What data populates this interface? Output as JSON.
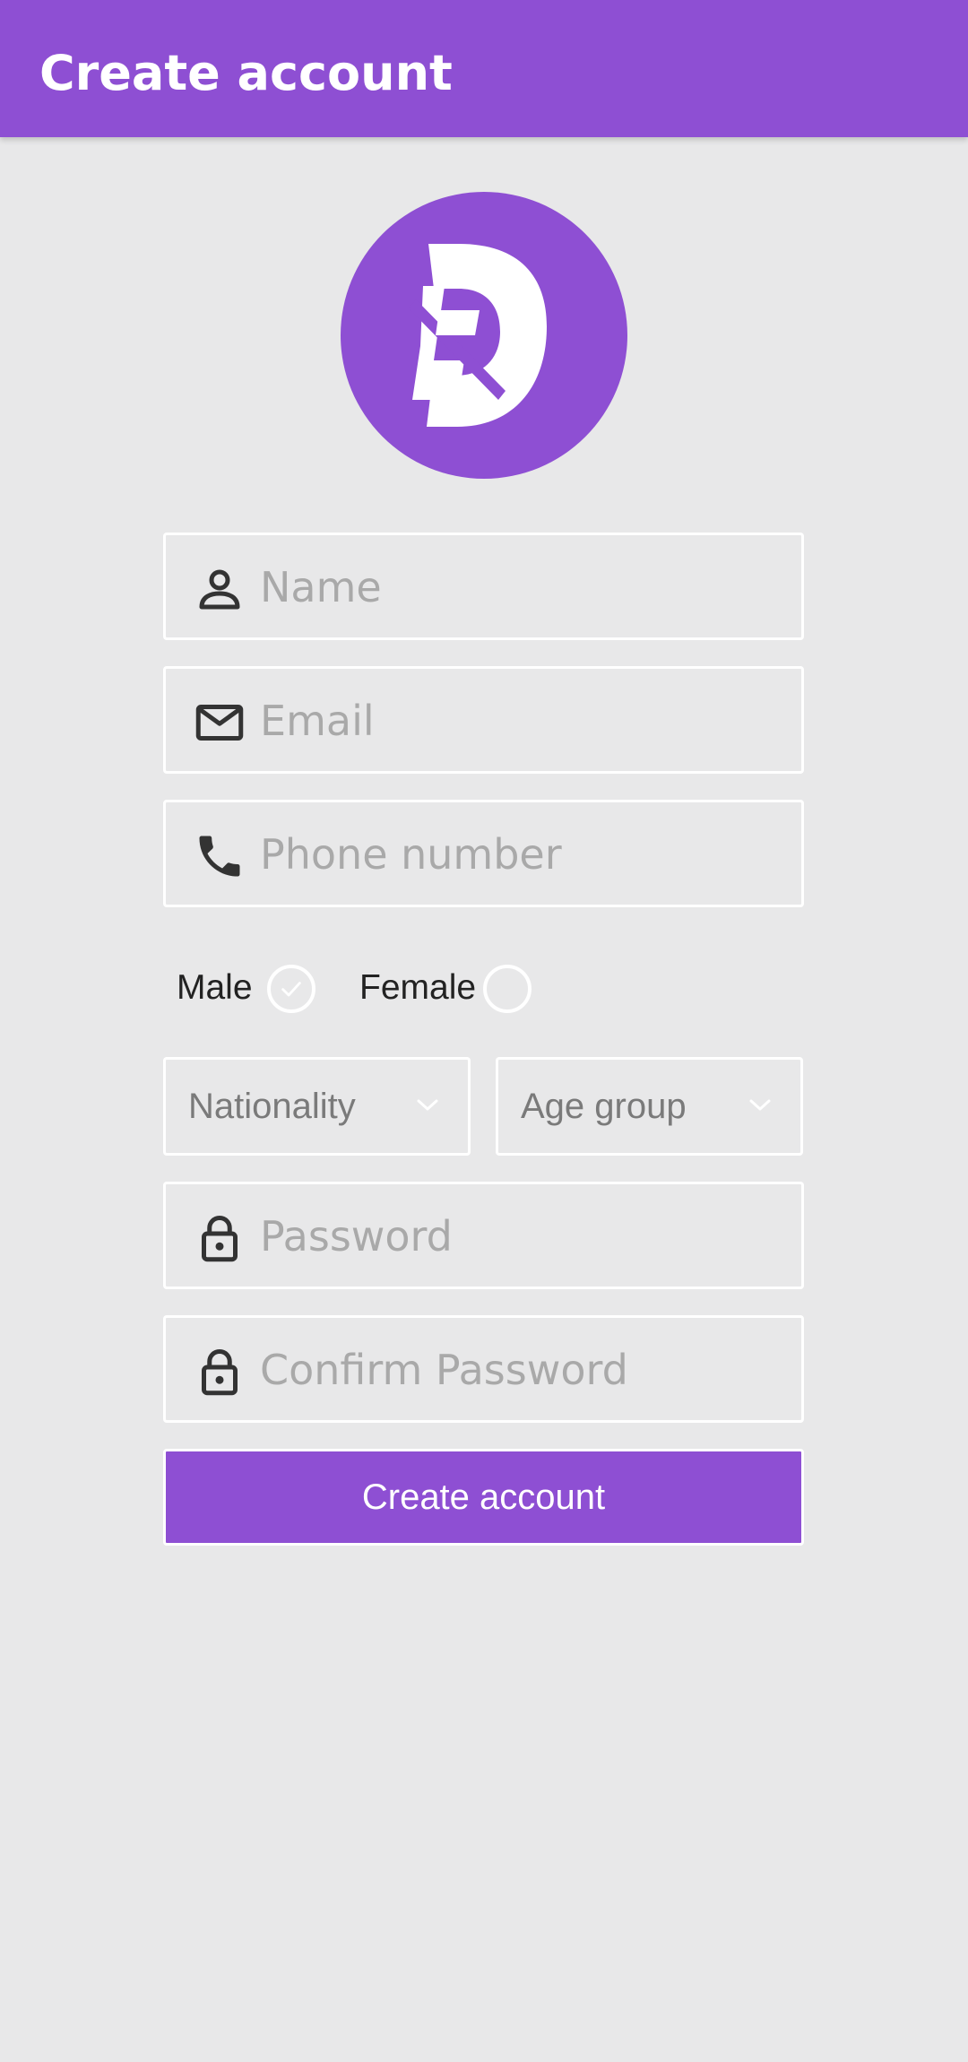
{
  "app_bar": {
    "title": "Create account",
    "color": "#8e4fd3"
  },
  "logo": {
    "icon": "db-monogram-logo"
  },
  "form": {
    "name": {
      "placeholder": "Name",
      "value": "",
      "icon": "person-icon"
    },
    "email": {
      "placeholder": "Email",
      "value": "",
      "icon": "mail-icon"
    },
    "phone": {
      "placeholder": "Phone number",
      "value": "",
      "icon": "phone-icon"
    },
    "gender": {
      "options": [
        {
          "label": "Male",
          "selected": true
        },
        {
          "label": "Female",
          "selected": false
        }
      ]
    },
    "nationality": {
      "label": "Nationality",
      "icon": "chevron-down-icon"
    },
    "age_group": {
      "label": "Age group",
      "icon": "chevron-down-icon"
    },
    "password": {
      "placeholder": "Password",
      "value": "",
      "icon": "lock-icon"
    },
    "confirm_password": {
      "placeholder": "Confirm Password",
      "value": "",
      "icon": "lock-icon"
    },
    "submit_label": "Create account"
  }
}
